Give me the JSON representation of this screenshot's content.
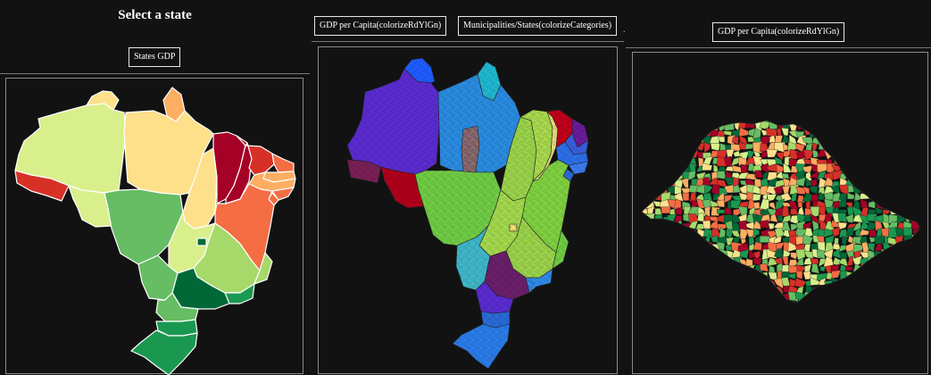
{
  "left_panel": {
    "title": "Select a state",
    "button_label": "States GDP",
    "map": {
      "color_scale": "RdYlGn",
      "regions": [
        {
          "id": "AC",
          "color": "#d73027"
        },
        {
          "id": "AM",
          "color": "#d9ef8b"
        },
        {
          "id": "RR",
          "color": "#fee08b"
        },
        {
          "id": "AP",
          "color": "#fdae61"
        },
        {
          "id": "PA",
          "color": "#fee08b"
        },
        {
          "id": "RO",
          "color": "#d9ef8b"
        },
        {
          "id": "MT",
          "color": "#66bd63"
        },
        {
          "id": "TO",
          "color": "#fee08b"
        },
        {
          "id": "MA",
          "color": "#a50026"
        },
        {
          "id": "PI",
          "color": "#a50026"
        },
        {
          "id": "CE",
          "color": "#d73027"
        },
        {
          "id": "RN",
          "color": "#f46d43"
        },
        {
          "id": "PB",
          "color": "#fdae61"
        },
        {
          "id": "PE",
          "color": "#fdae61"
        },
        {
          "id": "AL",
          "color": "#f46d43"
        },
        {
          "id": "SE",
          "color": "#f46d43"
        },
        {
          "id": "BA",
          "color": "#f46d43"
        },
        {
          "id": "GO",
          "color": "#d9ef8b"
        },
        {
          "id": "DF",
          "color": "#006837"
        },
        {
          "id": "MG",
          "color": "#a6d96a"
        },
        {
          "id": "ES",
          "color": "#a6d96a"
        },
        {
          "id": "MS",
          "color": "#66bd63"
        },
        {
          "id": "SP",
          "color": "#006837"
        },
        {
          "id": "RJ",
          "color": "#1a9850"
        },
        {
          "id": "PR",
          "color": "#66bd63"
        },
        {
          "id": "SC",
          "color": "#1a9850"
        },
        {
          "id": "RS",
          "color": "#1a9850"
        }
      ]
    }
  },
  "middle_panel": {
    "button1_label": "GDP per Capita(colorizeRdYlGn)",
    "button2_label": "Municipalities/States(colorizeCategories)",
    "map": {
      "color_mode": "categories",
      "regions": [
        {
          "id": "AC",
          "color": "#7b1f57"
        },
        {
          "id": "AM",
          "color": "#5a2bd0"
        },
        {
          "id": "RR",
          "color": "#1f5bff"
        },
        {
          "id": "AP",
          "color": "#1fb7cf"
        },
        {
          "id": "PA",
          "color": "#2a8be0"
        },
        {
          "id": "PA_sub",
          "color": "#8a6a70"
        },
        {
          "id": "RO",
          "color": "#b0001a"
        },
        {
          "id": "MT",
          "color": "#6fcc44"
        },
        {
          "id": "TO",
          "color": "#9ad24a"
        },
        {
          "id": "MA",
          "color": "#a8d84c"
        },
        {
          "id": "PI",
          "color": "#e6d87a"
        },
        {
          "id": "CE",
          "color": "#c0001a"
        },
        {
          "id": "RN",
          "color": "#6a1b9a"
        },
        {
          "id": "PB",
          "color": "#3a5ee0"
        },
        {
          "id": "PE",
          "color": "#2b6fe8"
        },
        {
          "id": "AL",
          "color": "#3a7bf0"
        },
        {
          "id": "SE",
          "color": "#2a6bd8"
        },
        {
          "id": "BA",
          "color": "#7fd040"
        },
        {
          "id": "GO",
          "color": "#a3d84c"
        },
        {
          "id": "DF",
          "color": "#f0e070"
        },
        {
          "id": "MG",
          "color": "#9ad24a"
        },
        {
          "id": "ES",
          "color": "#6fcc44"
        },
        {
          "id": "MS",
          "color": "#3fb6c8"
        },
        {
          "id": "SP",
          "color": "#6a1f6a"
        },
        {
          "id": "RJ",
          "color": "#2f8ae8"
        },
        {
          "id": "PR",
          "color": "#5a2bd0"
        },
        {
          "id": "SC",
          "color": "#2a6bd8"
        },
        {
          "id": "RS",
          "color": "#2a7be8"
        }
      ]
    }
  },
  "right_panel": {
    "button_label": "GDP per Capita(colorizeRdYlGn)",
    "map": {
      "color_scale": "RdYlGn",
      "palette": [
        "#a50026",
        "#d73027",
        "#f46d43",
        "#fdae61",
        "#fee08b",
        "#d9ef8b",
        "#a6d96a",
        "#66bd63",
        "#1a9850",
        "#006837"
      ]
    }
  }
}
